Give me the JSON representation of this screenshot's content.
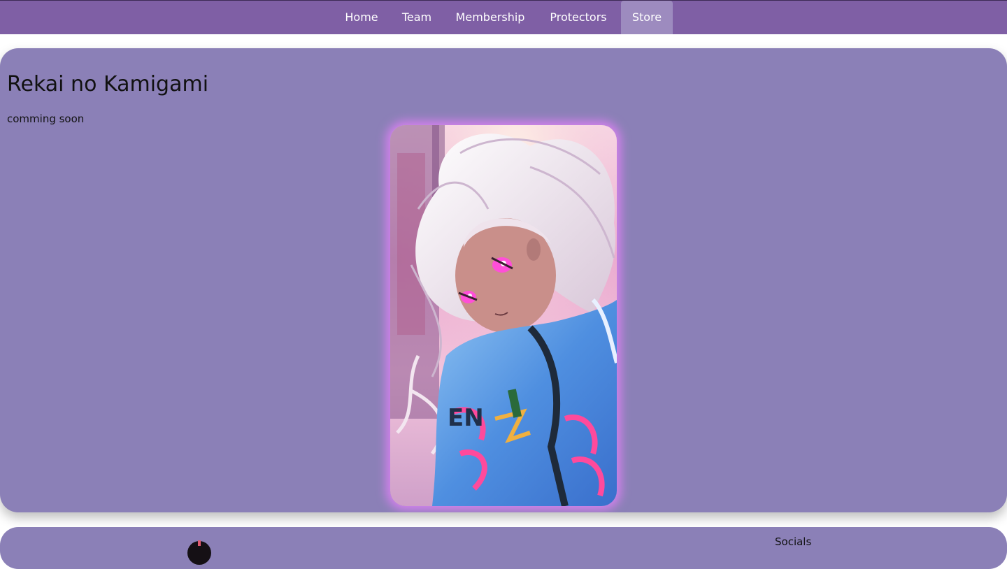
{
  "nav": {
    "items": [
      {
        "label": "Home",
        "active": false
      },
      {
        "label": "Team",
        "active": false
      },
      {
        "label": "Membership",
        "active": false
      },
      {
        "label": "Protectors",
        "active": false
      },
      {
        "label": "Store",
        "active": true
      }
    ]
  },
  "main": {
    "title": "Rekai no Kamigami",
    "subtitle": "comming soon",
    "hero_image_icon": "anime-girl-illustration"
  },
  "footer": {
    "socials_label": "Socials",
    "logo_icon": "brand-logo-icon"
  },
  "colors": {
    "navbar": "#7f5fa5",
    "nav_active": "#9d8bbf",
    "card": "#8b80b7",
    "glow": "#ec82ff"
  }
}
